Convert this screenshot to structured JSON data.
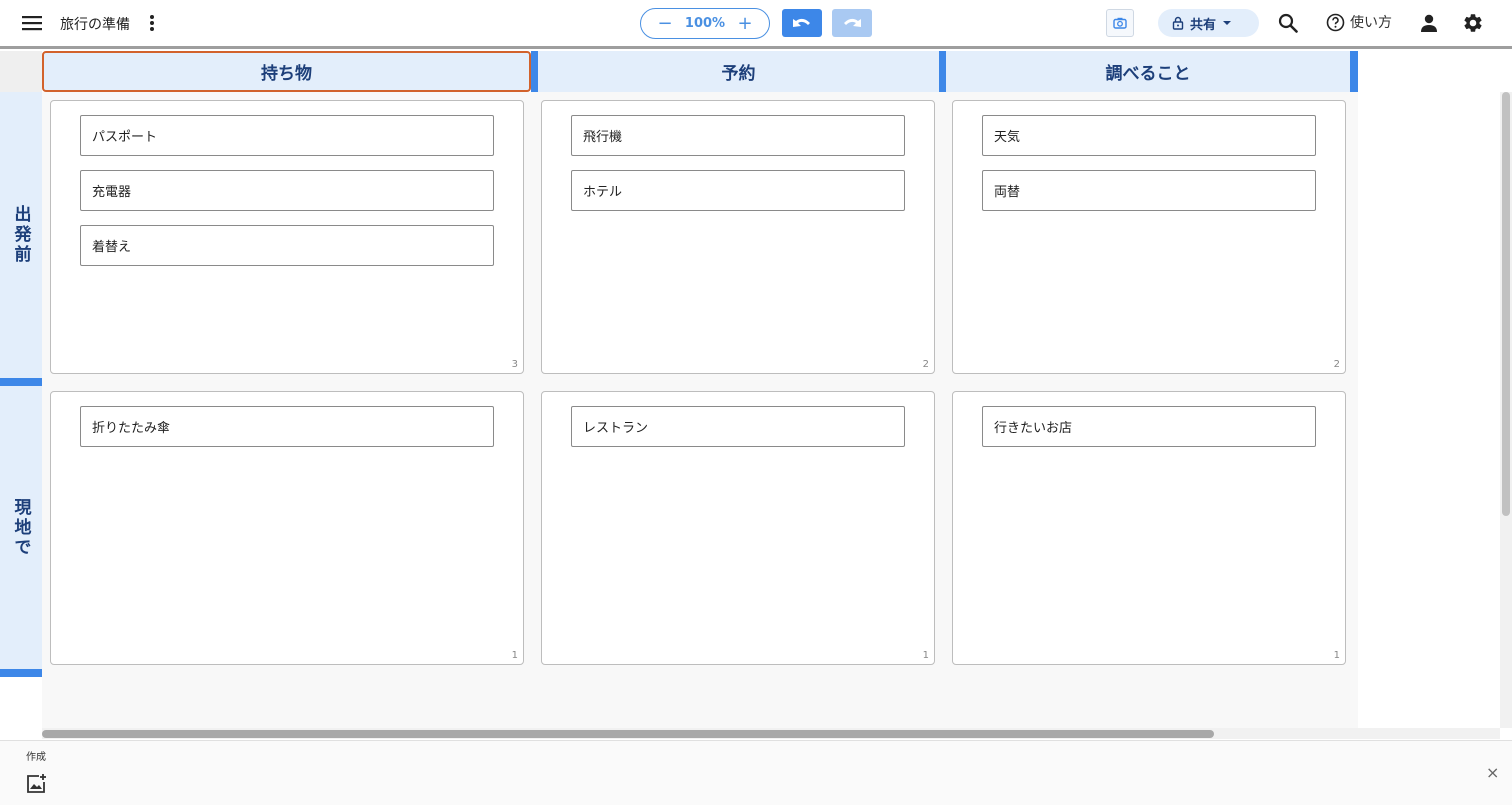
{
  "header": {
    "title": "旅行の準備",
    "zoom": {
      "minus": "−",
      "value": "100%",
      "plus": "+"
    },
    "share_label": "共有",
    "help_label": "使い方"
  },
  "board": {
    "columns": [
      {
        "label": "持ち物"
      },
      {
        "label": "予約"
      },
      {
        "label": "調べること"
      }
    ],
    "rows": [
      {
        "label": "出発前"
      },
      {
        "label": "現地で"
      }
    ],
    "cells": [
      {
        "count": "3",
        "cards": [
          "パスポート",
          "充電器",
          "着替え"
        ]
      },
      {
        "count": "2",
        "cards": [
          "飛行機",
          "ホテル"
        ]
      },
      {
        "count": "2",
        "cards": [
          "天気",
          "両替"
        ]
      },
      {
        "count": "1",
        "cards": [
          "折りたたみ傘"
        ]
      },
      {
        "count": "1",
        "cards": [
          "レストラン"
        ]
      },
      {
        "count": "1",
        "cards": [
          "行きたいお店"
        ]
      }
    ]
  },
  "bottom_panel": {
    "label": "作成",
    "close": "×"
  },
  "colors": {
    "accent": "#3d87e8",
    "header_bg": "#e3eefb",
    "header_text": "#1d3f7a",
    "selected_outline": "#d2622c"
  },
  "icons": [
    "menu-icon",
    "more-vert-icon",
    "undo-icon",
    "redo-icon",
    "camera-icon",
    "lock-icon",
    "dropdown-icon",
    "search-icon",
    "help-icon",
    "person-icon",
    "settings-icon",
    "add-image-icon",
    "close-icon"
  ]
}
